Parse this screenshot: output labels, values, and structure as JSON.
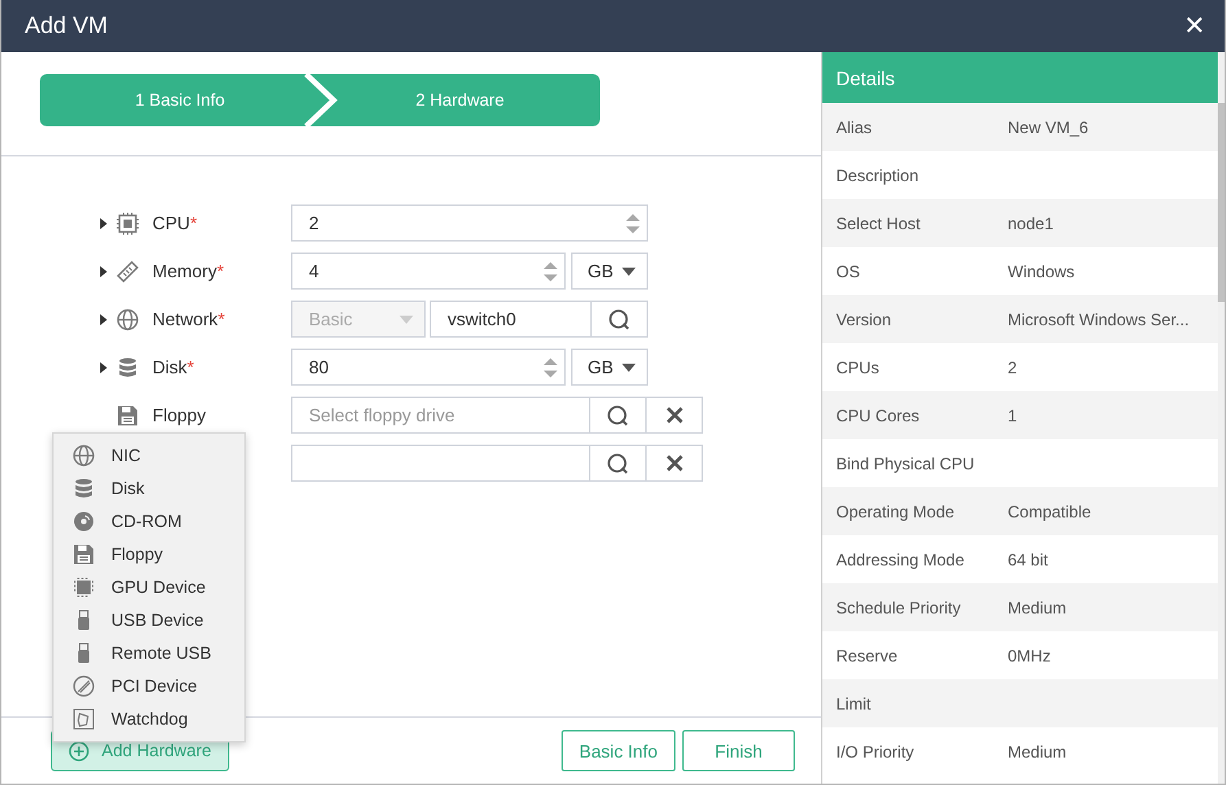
{
  "window": {
    "title": "Add VM",
    "close": "✕"
  },
  "steps": [
    {
      "label": "1 Basic Info"
    },
    {
      "label": "2 Hardware"
    }
  ],
  "hardware": [
    {
      "kind": "number",
      "label": "CPU",
      "mark": "*",
      "expandable": true,
      "value": "2"
    },
    {
      "kind": "number_unit",
      "label": "Memory",
      "mark": "*",
      "expandable": true,
      "value": "4",
      "unit": "GB"
    },
    {
      "kind": "select_search",
      "label": "Network",
      "mark": "*",
      "expandable": true,
      "mode": "Basic",
      "disabled": true,
      "value": "vswitch0"
    },
    {
      "kind": "number_unit",
      "label": "Disk",
      "mark": "*",
      "expandable": true,
      "value": "80",
      "unit": "GB"
    },
    {
      "kind": "search_clear",
      "label": "Floppy",
      "expandable": false,
      "placeholder": "Select floppy drive"
    },
    {
      "kind": "search_clear",
      "expandable": false
    }
  ],
  "add_menu": [
    {
      "label": "NIC"
    },
    {
      "label": "Disk"
    },
    {
      "label": "CD-ROM"
    },
    {
      "label": "Floppy"
    },
    {
      "label": "GPU Device"
    },
    {
      "label": "USB Device"
    },
    {
      "label": "Remote USB"
    },
    {
      "label": "PCI Device"
    },
    {
      "label": "Watchdog"
    }
  ],
  "footer": {
    "add_button": "Add Hardware",
    "buttons": [
      "Basic Info",
      "Finish"
    ]
  },
  "details": {
    "title": "Details",
    "rows": [
      {
        "label": "Alias",
        "value": "New VM_6"
      },
      {
        "label": "Description"
      },
      {
        "label": "Select Host",
        "value": "node1"
      },
      {
        "label": "OS",
        "value": "Windows"
      },
      {
        "label": "Version",
        "value": "Microsoft Windows Ser..."
      },
      {
        "label": "CPUs",
        "value": "2"
      },
      {
        "label": "CPU Cores",
        "value": "1"
      },
      {
        "label": "Bind Physical CPU"
      },
      {
        "label": "Operating Mode",
        "value": "Compatible"
      },
      {
        "label": "Addressing Mode",
        "value": "64 bit"
      },
      {
        "label": "Schedule Priority",
        "value": "Medium"
      },
      {
        "label": "Reserve",
        "value": "0MHz"
      },
      {
        "label": "Limit"
      },
      {
        "label": "I/O Priority",
        "value": "Medium"
      }
    ]
  }
}
